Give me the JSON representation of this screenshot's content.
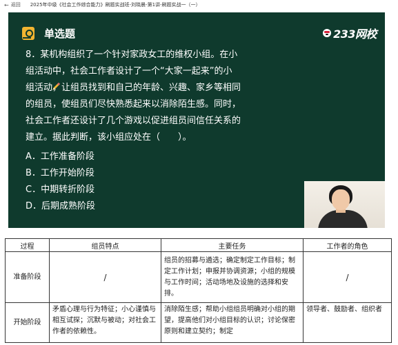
{
  "topbar": {
    "back_label": "返回",
    "title": "2025年中级《社会工作综合能力》刷题实战班-刘晓晨-第1讲-刷题实战一（一）"
  },
  "video": {
    "brand": "233网校",
    "question_type": "单选题",
    "question_lines": [
      "8．某机构组织了一个针对家政女工的维权小组。在小",
      "组活动中，社会工作者设计了一个“大家一起来”的小",
      "组活动，让组员找到和自己的年龄、兴趣、家乡等相同",
      "的组员，使组员们尽快熟悉起来以消除陌生感。同时，",
      "社会工作者还设计了几个游戏以促进组员间信任关系的",
      "建立。据此判断，该小组应处在（　　）。"
    ],
    "options": [
      "A．工作准备阶段",
      "B．工作开始阶段",
      "C．中期转折阶段",
      "D．后期成熟阶段"
    ]
  },
  "table": {
    "headers": [
      "过程",
      "组员特点",
      "主要任务",
      "工作者的角色"
    ],
    "rows": [
      {
        "stage": "准备阶段",
        "members": "/",
        "tasks": "组员的招募与遴选；确定制定工作目标；制定工作计划；申报并协调资源；小组的规模与工作时间；活动场地及设施的选择和安排。",
        "role": "/"
      },
      {
        "stage": "开始阶段",
        "members": "矛盾心理与行为特征；小心谨慎与相互试探；沉默与被动；对社会工作者的依赖性。",
        "tasks": "消除陌生感；帮助小组组员明确对小组的期望，提高他们对小组目标的认识；讨论保密原则和建立契约；制定",
        "role": "领导者、鼓励者、组织者"
      }
    ]
  },
  "colors": {
    "video_bg": "#0f3a2d",
    "accent_yellow": "#f2b531",
    "text_white": "#ffffff"
  },
  "icons": [
    "back-arrow-icon",
    "question-type-icon",
    "brand-mascot-icon",
    "pencil-cursor-icon"
  ]
}
